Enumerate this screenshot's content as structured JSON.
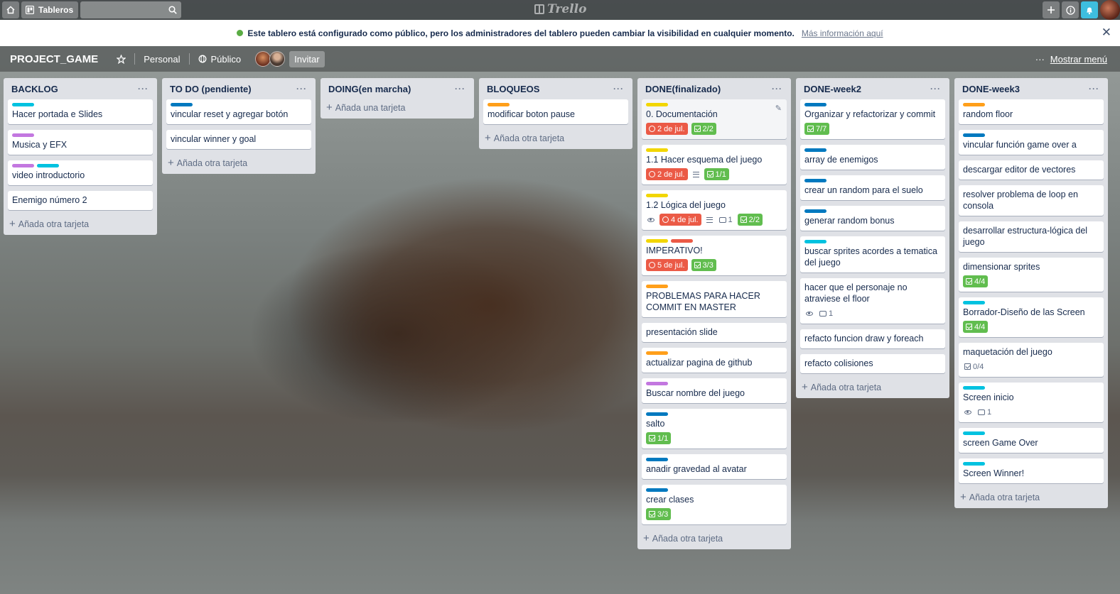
{
  "topbar": {
    "boards_label": "Tableros",
    "logo_text": "Trello"
  },
  "banner": {
    "text": "Este tablero está configurado como público, pero los administradores del tablero pueden cambiar la visibilidad en cualquier momento.",
    "link": "Más información aquí"
  },
  "board": {
    "title": "PROJECT_GAME",
    "team": "Personal",
    "visibility": "Público",
    "invite": "Invitar",
    "menu": "Mostrar menú"
  },
  "colors": {
    "green": "#61bd4f",
    "yellow": "#f2d600",
    "orange": "#ff9f1a",
    "red": "#eb5a46",
    "purple": "#c377e0",
    "blue": "#0079bf",
    "sky": "#00c2e0"
  },
  "lists": [
    {
      "title": "BACKLOG",
      "add_label": "Añada otra tarjeta",
      "cards": [
        {
          "title": "Hacer portada e Slides",
          "labels": [
            "sky"
          ]
        },
        {
          "title": "Musica y EFX",
          "labels": [
            "purple"
          ]
        },
        {
          "title": "video introductorio",
          "labels": [
            "purple",
            "sky"
          ]
        },
        {
          "title": "Enemigo número 2",
          "labels": []
        }
      ]
    },
    {
      "title": "TO DO (pendiente)",
      "add_label": "Añada otra tarjeta",
      "cards": [
        {
          "title": "vincular reset y agregar botón",
          "labels": [
            "blue"
          ]
        },
        {
          "title": "vincular winner y goal",
          "labels": []
        }
      ]
    },
    {
      "title": "DOING(en marcha)",
      "add_label": "Añada una tarjeta",
      "cards": []
    },
    {
      "title": "BLOQUEOS",
      "add_label": "Añada otra tarjeta",
      "cards": [
        {
          "title": "modificar boton pause",
          "labels": [
            "orange"
          ]
        }
      ]
    },
    {
      "title": "DONE(finalizado)",
      "add_label": "Añada otra tarjeta",
      "cards": [
        {
          "title": "0. Documentación",
          "labels": [
            "yellow"
          ],
          "due": "2 de jul.",
          "checklist": "2/2",
          "hover": true
        },
        {
          "title": "1.1 Hacer esquema del juego",
          "labels": [
            "yellow"
          ],
          "due": "2 de jul.",
          "description": true,
          "checklist": "1/1"
        },
        {
          "title": "1.2 Lógica del juego",
          "labels": [
            "yellow"
          ],
          "watch": true,
          "due": "4 de jul.",
          "description": true,
          "comments": "1",
          "checklist": "2/2"
        },
        {
          "title": "IMPERATIVO!",
          "labels": [
            "yellow",
            "red"
          ],
          "due": "5 de jul.",
          "checklist": "3/3"
        },
        {
          "title": "PROBLEMAS PARA HACER COMMIT EN MASTER",
          "labels": [
            "orange"
          ]
        },
        {
          "title": "presentación slide",
          "labels": []
        },
        {
          "title": "actualizar pagina de github",
          "labels": [
            "orange"
          ]
        },
        {
          "title": "Buscar nombre del juego",
          "labels": [
            "purple"
          ]
        },
        {
          "title": "salto",
          "labels": [
            "blue"
          ],
          "checklist": "1/1"
        },
        {
          "title": "anadir gravedad al avatar",
          "labels": [
            "blue"
          ]
        },
        {
          "title": "crear clases",
          "labels": [
            "blue"
          ],
          "checklist": "3/3"
        }
      ]
    },
    {
      "title": "DONE-week2",
      "add_label": "Añada otra tarjeta",
      "cards": [
        {
          "title": "Organizar y refactorizar y commit",
          "labels": [
            "blue"
          ],
          "checklist": "7/7"
        },
        {
          "title": "array de enemigos",
          "labels": [
            "blue"
          ]
        },
        {
          "title": "crear un random para el suelo",
          "labels": [
            "blue"
          ]
        },
        {
          "title": "generar random bonus",
          "labels": [
            "blue"
          ]
        },
        {
          "title": "buscar sprites acordes a tematica del juego",
          "labels": [
            "sky"
          ]
        },
        {
          "title": "hacer que el personaje no atraviese el floor",
          "labels": [],
          "watch": true,
          "comments": "1"
        },
        {
          "title": "refacto funcion draw y foreach",
          "labels": []
        },
        {
          "title": "refacto colisiones",
          "labels": []
        }
      ]
    },
    {
      "title": "DONE-week3",
      "add_label": "Añada otra tarjeta",
      "cards": [
        {
          "title": "random floor",
          "labels": [
            "orange"
          ]
        },
        {
          "title": "vincular función game over a",
          "labels": [
            "blue"
          ]
        },
        {
          "title": "descargar editor de vectores",
          "labels": []
        },
        {
          "title": "resolver problema de loop en consola",
          "labels": []
        },
        {
          "title": "desarrollar estructura-lógica del juego",
          "labels": []
        },
        {
          "title": "dimensionar sprites",
          "labels": [],
          "checklist": "4/4"
        },
        {
          "title": "Borrador-Diseño de las Screen",
          "labels": [
            "sky"
          ],
          "checklist": "4/4"
        },
        {
          "title": "maquetación del juego",
          "labels": [],
          "checklist_plain": "0/4"
        },
        {
          "title": "Screen inicio",
          "labels": [
            "sky"
          ],
          "watch": true,
          "comments": "1"
        },
        {
          "title": "screen Game Over",
          "labels": [
            "sky"
          ]
        },
        {
          "title": "Screen Winner!",
          "labels": [
            "sky"
          ]
        }
      ]
    }
  ]
}
